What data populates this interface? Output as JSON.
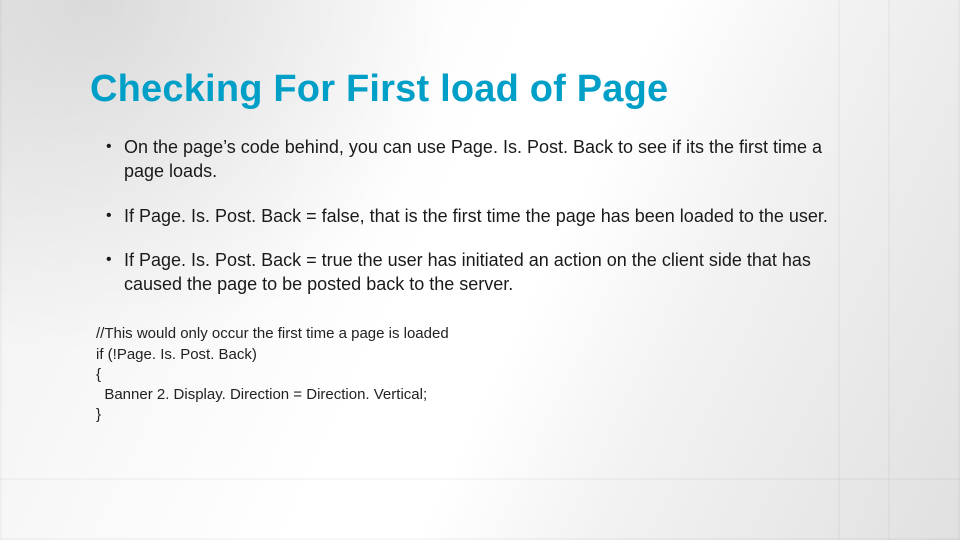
{
  "title": "Checking For First load of Page",
  "bullets": [
    "On the page’s code behind, you can use Page. Is. Post. Back to see if its the first time a page loads.",
    "If Page. Is. Post. Back = false, that is the first time the page has been loaded to the user.",
    "If Page. Is. Post. Back = true  the user has initiated an action on the client side that has caused the page to be posted back to the server."
  ],
  "code": {
    "line1": "//This would only occur the first time a page is loaded",
    "line2": "if (!Page. Is. Post. Back)",
    "line3": "{",
    "line4": "  Banner 2. Display. Direction = Direction. Vertical;",
    "line5": "}"
  }
}
